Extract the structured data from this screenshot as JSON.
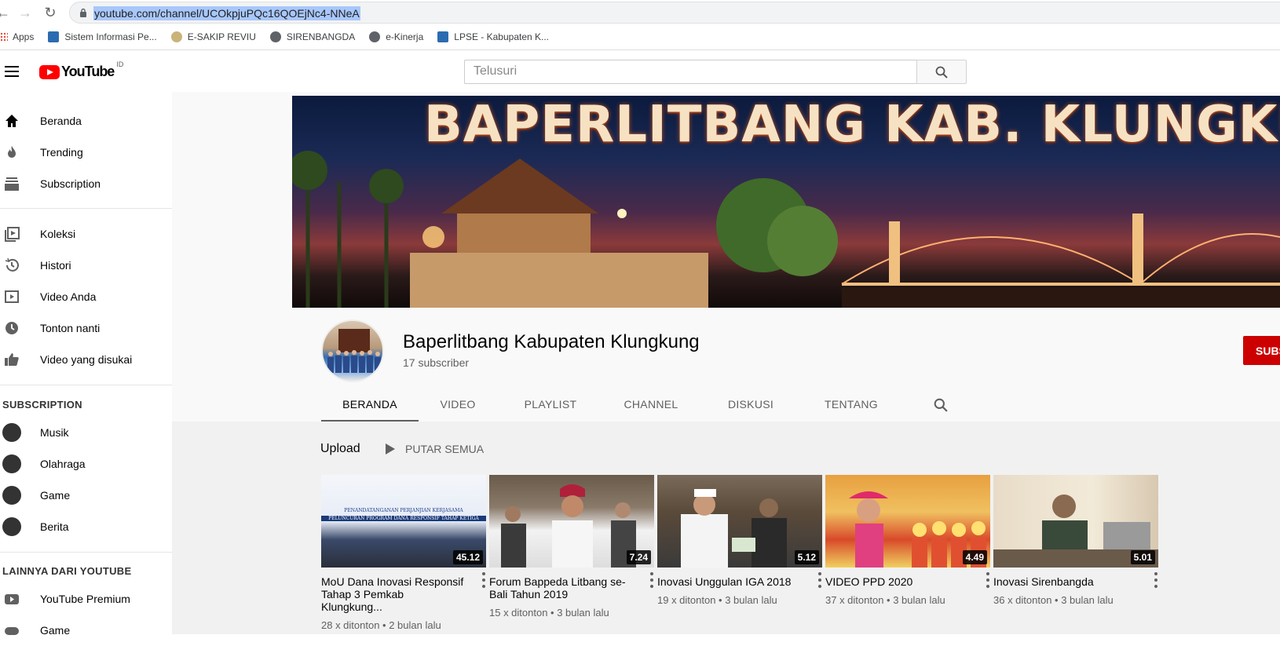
{
  "browser": {
    "url": "youtube.com/channel/UCOkpjuPQc16QOEjNc4-NNeA",
    "bookmarks": [
      "Apps",
      "Sistem Informasi Pe...",
      "E-SAKIP REVIU",
      "SIRENBANGDA",
      "e-Kinerja",
      "LPSE - Kabupaten K..."
    ]
  },
  "header": {
    "logo_text": "YouTube",
    "logo_region": "ID",
    "search_placeholder": "Telusuri"
  },
  "sidebar": {
    "main": [
      "Beranda",
      "Trending",
      "Subscription"
    ],
    "library": [
      "Koleksi",
      "Histori",
      "Video Anda",
      "Tonton nanti",
      "Video yang disukai"
    ],
    "subscription_heading": "SUBSCRIPTION",
    "subscriptions": [
      "Musik",
      "Olahraga",
      "Game",
      "Berita"
    ],
    "more_heading": "LAINNYA DARI YOUTUBE",
    "more": [
      "YouTube Premium",
      "Game"
    ]
  },
  "channel": {
    "banner_title": "BAPERLITBANG KAB. KLUNGKUNG",
    "name": "Baperlitbang Kabupaten Klungkung",
    "subscribers": "17 subscriber",
    "subscribe_label": "SUBSCRIBE",
    "tabs": [
      "BERANDA",
      "VIDEO",
      "PLAYLIST",
      "CHANNEL",
      "DISKUSI",
      "TENTANG"
    ]
  },
  "uploads": {
    "title": "Upload",
    "play_all": "PUTAR SEMUA",
    "videos": [
      {
        "title": "MoU Dana Inovasi Responsif Tahap 3 Pemkab Klungkung...",
        "meta": "28 x ditonton • 2 bulan lalu",
        "duration": "45.12",
        "thumb_caption": "PENANDATANGANAN PERJANJIAN KERJASAMA",
        "thumb_caption2": "PELUNCURAN PROGRAM DANA RESPONSIF TAHAP KETIGA"
      },
      {
        "title": "Forum Bappeda Litbang se-Bali Tahun 2019",
        "meta": "15 x ditonton • 3 bulan lalu",
        "duration": "7.24"
      },
      {
        "title": "Inovasi Unggulan IGA 2018",
        "meta": "19 x ditonton • 3 bulan lalu",
        "duration": "5.12"
      },
      {
        "title": "VIDEO PPD 2020",
        "meta": "37 x ditonton • 3 bulan lalu",
        "duration": "4.49"
      },
      {
        "title": "Inovasi Sirenbangda",
        "meta": "36 x ditonton • 3 bulan lalu",
        "duration": "5.01"
      }
    ]
  },
  "colors": {
    "accent": "#cc0000",
    "logo_red": "#ff0000"
  }
}
